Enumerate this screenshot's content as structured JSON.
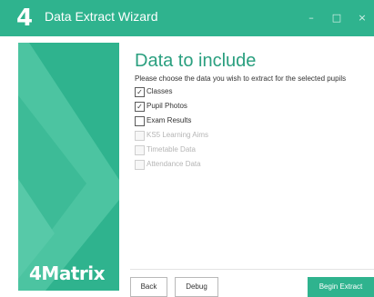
{
  "window": {
    "logo_glyph": "4",
    "title": "Data Extract Wizard",
    "controls": {
      "minimize": "–",
      "maximize": "□",
      "close": "×"
    }
  },
  "sidebar": {
    "brand": "4Matrix"
  },
  "main": {
    "heading": "Data to include",
    "instructions": "Please choose the data you wish to extract for the selected pupils",
    "options": [
      {
        "label": "Classes",
        "checked": true,
        "enabled": true
      },
      {
        "label": "Pupil Photos",
        "checked": true,
        "enabled": true
      },
      {
        "label": "Exam Results",
        "checked": false,
        "enabled": true
      },
      {
        "label": "KS5 Learning Aims",
        "checked": false,
        "enabled": false
      },
      {
        "label": "Timetable Data",
        "checked": false,
        "enabled": false
      },
      {
        "label": "Attendance Data",
        "checked": false,
        "enabled": false
      }
    ],
    "check_mark": "✓"
  },
  "footer": {
    "back_label": "Back",
    "debug_label": "Debug",
    "begin_label": "Begin Extract"
  },
  "colors": {
    "brand_green": "#2fb38e",
    "heading_green": "#2a9f7f"
  }
}
